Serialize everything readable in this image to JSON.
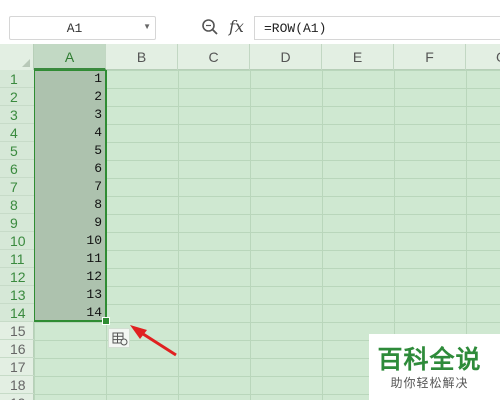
{
  "formula_bar": {
    "name_box": "A1",
    "fx_label": "fx",
    "formula": "=ROW(A1)"
  },
  "columns": [
    "A",
    "B",
    "C",
    "D",
    "E",
    "F",
    "G"
  ],
  "rows": [
    "1",
    "2",
    "3",
    "4",
    "5",
    "6",
    "7",
    "8",
    "9",
    "10",
    "11",
    "12",
    "13",
    "14",
    "15",
    "16",
    "17",
    "18",
    "19"
  ],
  "cells_A": [
    "1",
    "2",
    "3",
    "4",
    "5",
    "6",
    "7",
    "8",
    "9",
    "10",
    "11",
    "12",
    "13",
    "14"
  ],
  "selected_column": "A",
  "selected_rows_count": 14,
  "icons": {
    "zoom": "zoom-icon",
    "name_box_dropdown": "chevron-down-icon",
    "autofill": "autofill-options-icon",
    "arrow": "red-arrow-icon"
  },
  "colors": {
    "accent": "#2f8c33",
    "sheet_bg": "#cfe8d1",
    "arrow": "#e02020"
  },
  "watermark": {
    "main": "百科全说",
    "sub": "助你轻松解决"
  }
}
